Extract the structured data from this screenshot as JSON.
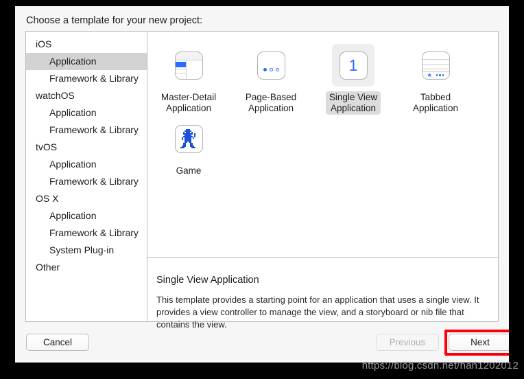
{
  "dialog": {
    "title": "Choose a template for your new project:"
  },
  "sidebar": {
    "groups": [
      {
        "label": "iOS",
        "selected": false,
        "child": false
      },
      {
        "label": "Application",
        "selected": true,
        "child": true
      },
      {
        "label": "Framework & Library",
        "selected": false,
        "child": true
      },
      {
        "label": "watchOS",
        "selected": false,
        "child": false
      },
      {
        "label": "Application",
        "selected": false,
        "child": true
      },
      {
        "label": "Framework & Library",
        "selected": false,
        "child": true
      },
      {
        "label": "tvOS",
        "selected": false,
        "child": false
      },
      {
        "label": "Application",
        "selected": false,
        "child": true
      },
      {
        "label": "Framework & Library",
        "selected": false,
        "child": true
      },
      {
        "label": "OS X",
        "selected": false,
        "child": false
      },
      {
        "label": "Application",
        "selected": false,
        "child": true
      },
      {
        "label": "Framework & Library",
        "selected": false,
        "child": true
      },
      {
        "label": "System Plug-in",
        "selected": false,
        "child": true
      },
      {
        "label": "Other",
        "selected": false,
        "child": false
      }
    ]
  },
  "templates": {
    "row1": [
      {
        "icon": "master-detail-icon",
        "label": "Master-Detail\nApplication",
        "selected": false
      },
      {
        "icon": "page-based-icon",
        "label": "Page-Based\nApplication",
        "selected": false
      },
      {
        "icon": "single-view-icon",
        "label": "Single View\nApplication",
        "selected": true,
        "badge": "1"
      },
      {
        "icon": "tabbed-icon",
        "label": "Tabbed\nApplication",
        "selected": false
      }
    ],
    "row2": [
      {
        "icon": "game-icon",
        "label": "Game",
        "selected": false
      }
    ]
  },
  "description": {
    "title": "Single View Application",
    "body": "This template provides a starting point for an application that uses a single view. It provides a view controller to manage the view, and a storyboard or nib file that contains the view."
  },
  "footer": {
    "cancel_label": "Cancel",
    "previous_label": "Previous",
    "next_label": "Next",
    "previous_disabled": true,
    "annotation_color": "#fb0007"
  },
  "watermark": {
    "text": "https://blog.csdn.net/han1202012"
  },
  "colors": {
    "accent_blue": "#2b6bff",
    "selection_gray": "#d2d2d2",
    "tile_selection_gray": "#eeeeee"
  }
}
